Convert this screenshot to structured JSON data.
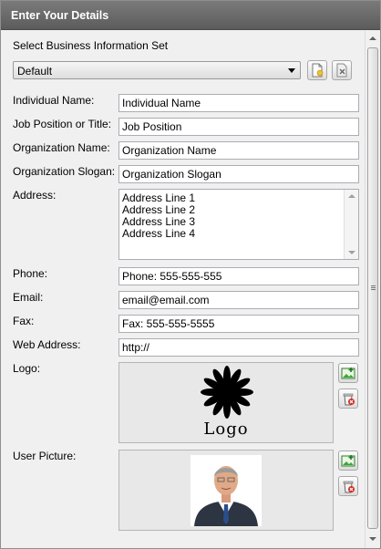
{
  "window": {
    "title": "Enter Your Details"
  },
  "business_set": {
    "label": "Select Business Information Set",
    "selected": "Default",
    "new_icon": "new-document-icon",
    "delete_icon": "delete-document-icon"
  },
  "fields": {
    "individual_name": {
      "label": "Individual Name:",
      "value": "Individual Name"
    },
    "job_position": {
      "label": "Job Position or Title:",
      "value": "Job Position"
    },
    "organization_name": {
      "label": "Organization Name:",
      "value": "Organization Name"
    },
    "organization_slogan": {
      "label": "Organization Slogan:",
      "value": "Organization Slogan"
    },
    "address": {
      "label": "Address:",
      "lines": [
        "Address Line 1",
        "Address Line 2",
        "Address Line 3",
        "Address Line 4"
      ]
    },
    "phone": {
      "label": "Phone:",
      "value": "Phone: 555-555-555"
    },
    "email": {
      "label": "Email:",
      "value": "email@email.com"
    },
    "fax": {
      "label": "Fax:",
      "value": "Fax: 555-555-5555"
    },
    "web_address": {
      "label": "Web Address:",
      "value": "http://"
    }
  },
  "logo": {
    "label": "Logo:",
    "image_text": "Logo",
    "add_icon": "add-image-icon",
    "delete_icon": "delete-image-icon"
  },
  "user_picture": {
    "label": "User Picture:",
    "add_icon": "add-image-icon",
    "delete_icon": "delete-image-icon"
  },
  "colors": {
    "title_bar": "#666666",
    "panel_bg": "#f0f0f0",
    "field_border": "#abadb3",
    "delete_red": "#d42a1f",
    "add_green": "#2e9a2e"
  }
}
